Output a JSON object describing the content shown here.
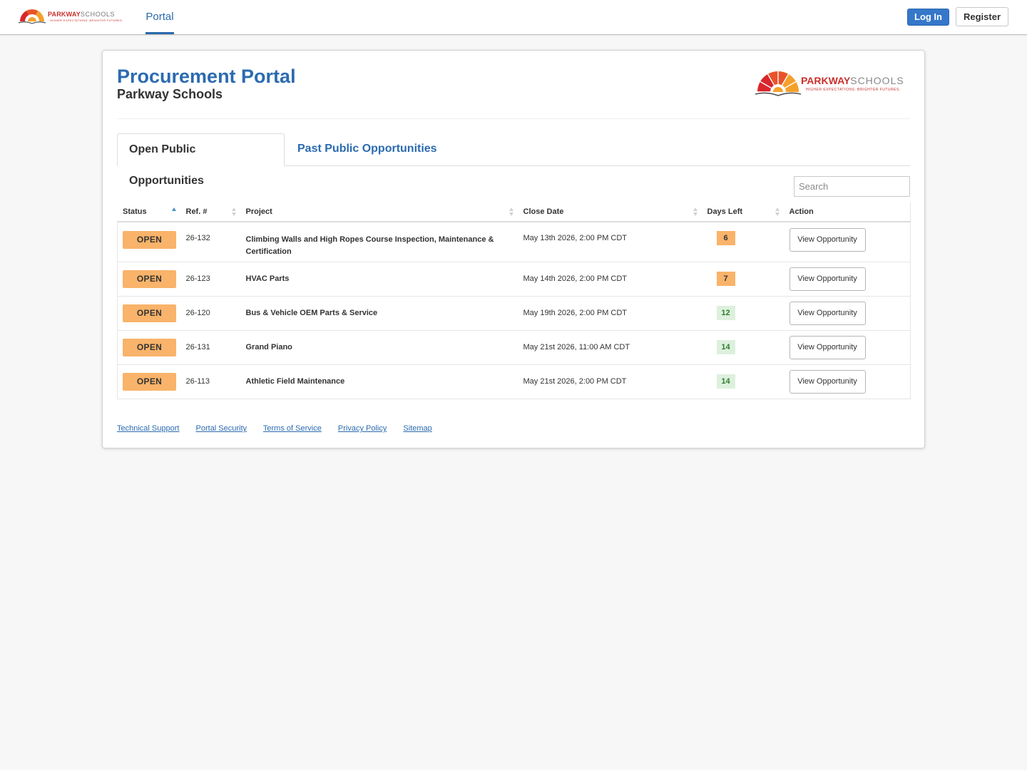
{
  "brand": {
    "name_strong": "PARKWAY",
    "name_light": "SCHOOLS",
    "tagline": "HIGHER EXPECTATIONS. BRIGHTER FUTURES.",
    "accent_color": "#c9302c",
    "logo_icon": "sunburst-book-logo"
  },
  "nav": {
    "portal_label": "Portal",
    "login_label": "Log In",
    "register_label": "Register"
  },
  "header": {
    "title": "Procurement Portal",
    "subtitle": "Parkway Schools"
  },
  "tabs": [
    {
      "label": "Open Public Opportunities",
      "active": true
    },
    {
      "label": "Past Public Opportunities",
      "active": false
    }
  ],
  "search": {
    "placeholder": "Search",
    "value": ""
  },
  "table": {
    "columns": [
      "Status",
      "Ref. #",
      "Project",
      "Close Date",
      "Days Left",
      "Action"
    ],
    "sorted_column": "Status",
    "sort_direction": "ascending",
    "rows": [
      {
        "status": "OPEN",
        "ref": "26-132",
        "project": "Climbing Walls and High Ropes Course Inspection, Maintenance & Certification",
        "close_date": "May 13th 2026, 2:00 PM CDT",
        "days_left": "6",
        "days_level": "warn",
        "action": "View Opportunity"
      },
      {
        "status": "OPEN",
        "ref": "26-123",
        "project": "HVAC Parts",
        "close_date": "May 14th 2026, 2:00 PM CDT",
        "days_left": "7",
        "days_level": "warn",
        "action": "View Opportunity"
      },
      {
        "status": "OPEN",
        "ref": "26-120",
        "project": "Bus & Vehicle OEM Parts & Service",
        "close_date": "May 19th 2026, 2:00 PM CDT",
        "days_left": "12",
        "days_level": "ok",
        "action": "View Opportunity"
      },
      {
        "status": "OPEN",
        "ref": "26-131",
        "project": "Grand Piano",
        "close_date": "May 21st 2026, 11:00 AM CDT",
        "days_left": "14",
        "days_level": "ok",
        "action": "View Opportunity"
      },
      {
        "status": "OPEN",
        "ref": "26-113",
        "project": "Athletic Field Maintenance",
        "close_date": "May 21st 2026, 2:00 PM CDT",
        "days_left": "14",
        "days_level": "ok",
        "action": "View Opportunity"
      }
    ]
  },
  "footer": {
    "links": [
      "Technical Support",
      "Portal Security",
      "Terms of Service",
      "Privacy Policy",
      "Sitemap"
    ]
  },
  "colors": {
    "primary": "#2b6bb0",
    "button_primary": "#3577c9",
    "status_open": "#f9b36a",
    "days_ok_bg": "#ddf0dd",
    "days_ok_text": "#2e7d32"
  }
}
